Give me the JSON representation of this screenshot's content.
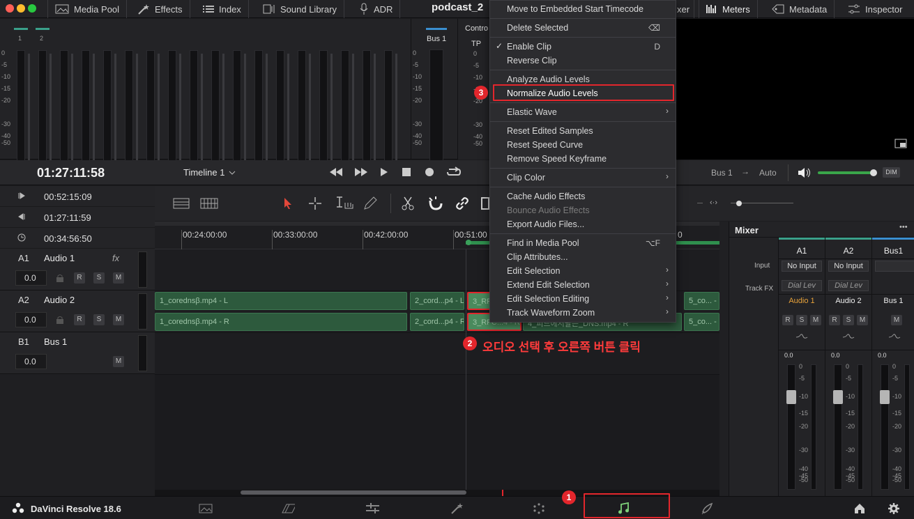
{
  "topbar": {
    "project_name": "podcast_2",
    "tabs": [
      {
        "label": "Media Pool",
        "icon": "media-pool-icon"
      },
      {
        "label": "Effects",
        "icon": "effects-wand-icon"
      },
      {
        "label": "Index",
        "icon": "list-icon"
      },
      {
        "label": "Sound Library",
        "icon": "sound-library-icon"
      },
      {
        "label": "ADR",
        "icon": "microphone-icon"
      },
      {
        "label": "xer"
      },
      {
        "label": "Meters",
        "icon": "meters-icon"
      },
      {
        "label": "Metadata",
        "icon": "metadata-icon"
      },
      {
        "label": "Inspector",
        "icon": "inspector-icon"
      }
    ]
  },
  "meters": {
    "channels": [
      "1",
      "2"
    ],
    "scale": [
      "0",
      "-5",
      "-10",
      "-15",
      "-20",
      "-30",
      "-40",
      "-50"
    ],
    "bus_label": "Bus 1",
    "control_label": "Contro",
    "tp_label": "TP"
  },
  "transport": {
    "timecode": "01:27:11:58",
    "timeline_name": "Timeline 1",
    "bus_route": "Bus 1",
    "bus_mode": "Auto",
    "dim_label": "DIM"
  },
  "timecodes": [
    "00:52:15:09",
    "01:27:11:59",
    "00:34:56:50"
  ],
  "tracks": [
    {
      "id": "A1",
      "name": "Audio 1",
      "volume": "0.0",
      "fx": "fx",
      "buttons": [
        "R",
        "S",
        "M"
      ]
    },
    {
      "id": "A2",
      "name": "Audio 2",
      "volume": "0.0",
      "buttons": [
        "R",
        "S",
        "M"
      ]
    },
    {
      "id": "B1",
      "name": "Bus 1",
      "volume": "0.0",
      "buttons": [
        "M"
      ]
    }
  ],
  "ruler": [
    "00:24:00:00",
    "00:33:00:00",
    "00:42:00:00",
    "00:51:00",
    "0"
  ],
  "clips": {
    "left": [
      "1_corednsβ.mp4 - L",
      "2_cord...p4 - L",
      "3_RF",
      "5_co... - L"
    ],
    "right": [
      "1_corednsβ.mp4 - R",
      "2_cord...p4 - R",
      "3_RFC...4 - R",
      "4_피드에서팔는_DNS.mp4 - R",
      "5_co... - R"
    ]
  },
  "context_menu": {
    "items": [
      {
        "label": "Move to Embedded Start Timecode"
      },
      {
        "label": "Delete Selected",
        "shortcut": "⌫"
      },
      {
        "label": "Enable Clip",
        "shortcut": "D",
        "checked": "✓"
      },
      {
        "label": "Reverse Clip"
      },
      {
        "label": "Analyze Audio Levels"
      },
      {
        "label": "Normalize Audio Levels"
      },
      {
        "label": "Elastic Wave",
        "arrow": "›"
      },
      {
        "label": "Reset Edited Samples"
      },
      {
        "label": "Reset Speed Curve"
      },
      {
        "label": "Remove Speed Keyframe"
      },
      {
        "label": "Clip Color",
        "arrow": "›"
      },
      {
        "label": "Cache Audio Effects"
      },
      {
        "label": "Bounce Audio Effects",
        "disabled": true
      },
      {
        "label": "Export Audio Files..."
      },
      {
        "label": "Find in Media Pool",
        "shortcut": "⌥F"
      },
      {
        "label": "Clip Attributes..."
      },
      {
        "label": "Edit Selection",
        "arrow": "›"
      },
      {
        "label": "Extend Edit Selection",
        "arrow": "›"
      },
      {
        "label": "Edit Selection Editing",
        "arrow": "›"
      },
      {
        "label": "Track Waveform Zoom",
        "arrow": "›"
      }
    ]
  },
  "mixer": {
    "title": "Mixer",
    "more": "•••",
    "row_input": "Input",
    "row_trackfx": "Track FX",
    "channels": [
      {
        "header": "A1",
        "input": "No Input",
        "fx": "Dial Lev",
        "name": "Audio 1",
        "buttons": [
          "R",
          "S",
          "M"
        ],
        "level": "0.0",
        "name_color": "#e8a23a"
      },
      {
        "header": "A2",
        "input": "No Input",
        "fx": "Dial Lev",
        "name": "Audio 2",
        "buttons": [
          "R",
          "S",
          "M"
        ],
        "level": "0.0",
        "name_color": "#eeeeee"
      },
      {
        "header": "Bus1",
        "input": "",
        "fx": "",
        "name": "Bus 1",
        "buttons": [
          "M"
        ],
        "level": "0.0",
        "name_color": "#eeeeee"
      }
    ],
    "scale": [
      "0",
      "-5",
      "-10",
      "-15",
      "-20",
      "-30",
      "-40",
      "-45",
      "-50"
    ]
  },
  "bottom": {
    "app_name": "DaVinci Resolve 18.6"
  },
  "annotations": {
    "badge1": "1",
    "badge2": "2",
    "badge3": "3",
    "instruction": "오디오 선택 후 오른쪽 버튼 클릭"
  },
  "colors": {
    "accent_red": "#e3262c",
    "clip_green": "#2d5a3d",
    "fairlight_green": "#7fd17a"
  }
}
